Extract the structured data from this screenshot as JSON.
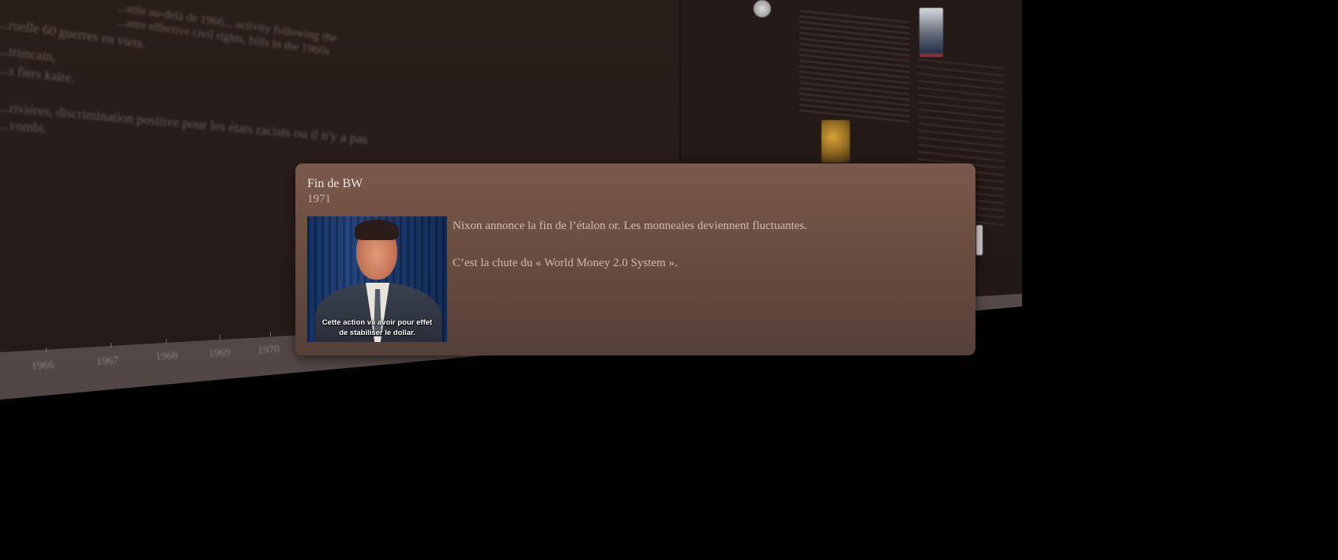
{
  "popup": {
    "title": "Fin de BW",
    "year": "1971",
    "image_caption_line1": "Cette action va avoir pour effet",
    "image_caption_line2": "de stabiliser le dollar.",
    "description_line1": "Nixon annonce la fin de l’étalon or. Les monneaies deviennent fluctuantes.",
    "description_line2": "C’est la chute du « World Money 2.0 System »."
  },
  "background": {
    "text_lines": [
      "...stile au-delà de 1966... activity following the",
      "...ante effective civil rights, bills in the 1960s",
      "...ruelle 60 guerres en viets.",
      "...truncain,",
      "...s fiers kaire.",
      "...riviéres, discrimination positive pour les états racists ou il n'y a pas",
      "...vombi."
    ],
    "timeline_years": [
      "1966",
      "1967",
      "1968",
      "1969",
      "1970"
    ]
  },
  "colors": {
    "page_background": "#000000",
    "wall": "#261b18",
    "popup_top": "#7a5a4c",
    "popup_bottom": "#56403a",
    "popup_title": "#f1e6e0",
    "popup_text": "#d2bcb2"
  }
}
